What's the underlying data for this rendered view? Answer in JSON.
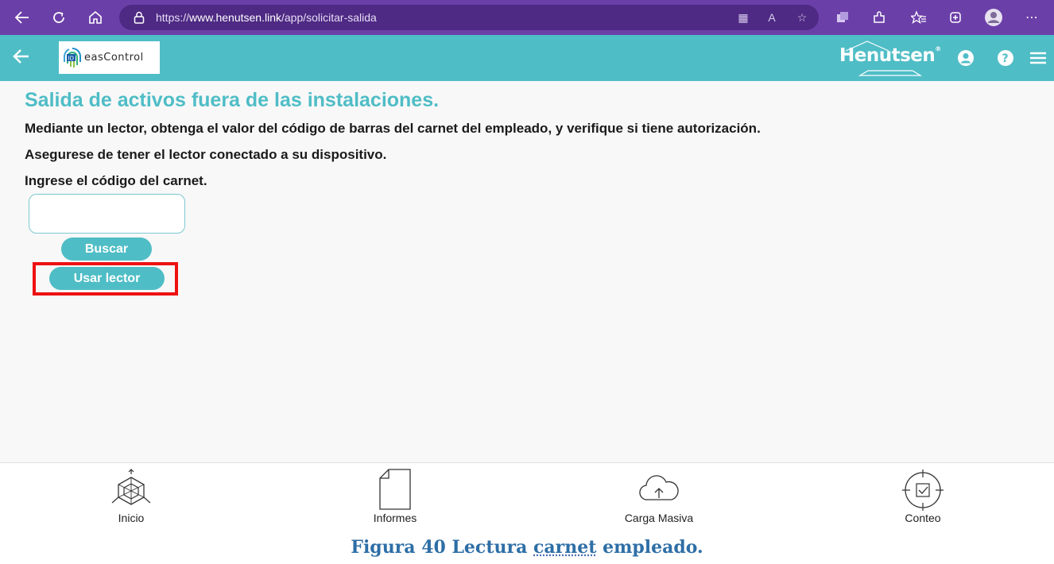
{
  "browser": {
    "url_prefix": "https://",
    "url_host": "www.henutsen.link",
    "url_path": "/app/solicitar-salida"
  },
  "header": {
    "logo_text": "easControl",
    "brand": "Henutsen",
    "brand_mark": "®"
  },
  "main": {
    "title": "Salida de activos fuera de las instalaciones.",
    "instruction_1": "Mediante un lector, obtenga el valor del código de barras del carnet del empleado, y verifique si tiene autorización.",
    "instruction_2": "Asegurese de tener el lector conectado a su dispositivo.",
    "instruction_3": "Ingrese el código del carnet.",
    "code_input_value": "",
    "search_button": "Buscar",
    "reader_button": "Usar lector"
  },
  "bottom_nav": {
    "items": [
      {
        "label": "Inicio",
        "icon": "home-cube-icon"
      },
      {
        "label": "Informes",
        "icon": "document-icon"
      },
      {
        "label": "Carga Masiva",
        "icon": "cloud-upload-icon"
      },
      {
        "label": "Conteo",
        "icon": "target-check-icon"
      }
    ]
  },
  "caption": {
    "part1": "Figura 40 Lectura ",
    "part2": "carnet",
    "part3": " empleado."
  },
  "colors": {
    "browser_chrome": "#6b3fa8",
    "accent": "#4fbdc6",
    "highlight": "#ee1111",
    "caption": "#2e6ea6"
  }
}
